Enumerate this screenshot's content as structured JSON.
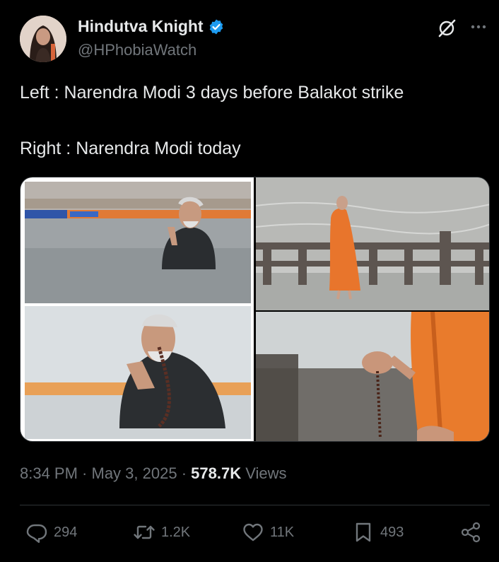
{
  "author": {
    "name": "Hindutva Knight",
    "handle": "@HPhobiaWatch"
  },
  "icons": {
    "verified": "verified-badge-icon",
    "grok": "grok-icon",
    "more": "more-options-icon"
  },
  "tweet": {
    "line1": "Left : Narendra Modi 3 days before Balakot strike",
    "line2": "Right : Narendra Modi today"
  },
  "media": {
    "photos": [
      "left-top",
      "left-bottom",
      "right-top",
      "right-bottom"
    ]
  },
  "meta": {
    "time": "8:34 PM",
    "sep1": " · ",
    "date": "May 3, 2025",
    "sep2": " · ",
    "views_count": "578.7K",
    "views_label": " Views"
  },
  "actions": {
    "replies": "294",
    "retweets": "1.2K",
    "likes": "11K",
    "bookmarks": "493"
  },
  "colors": {
    "background": "#000000",
    "text": "#e7e9ea",
    "muted": "#71767b",
    "verified": "#1d9bf0",
    "border": "#2f3336"
  }
}
